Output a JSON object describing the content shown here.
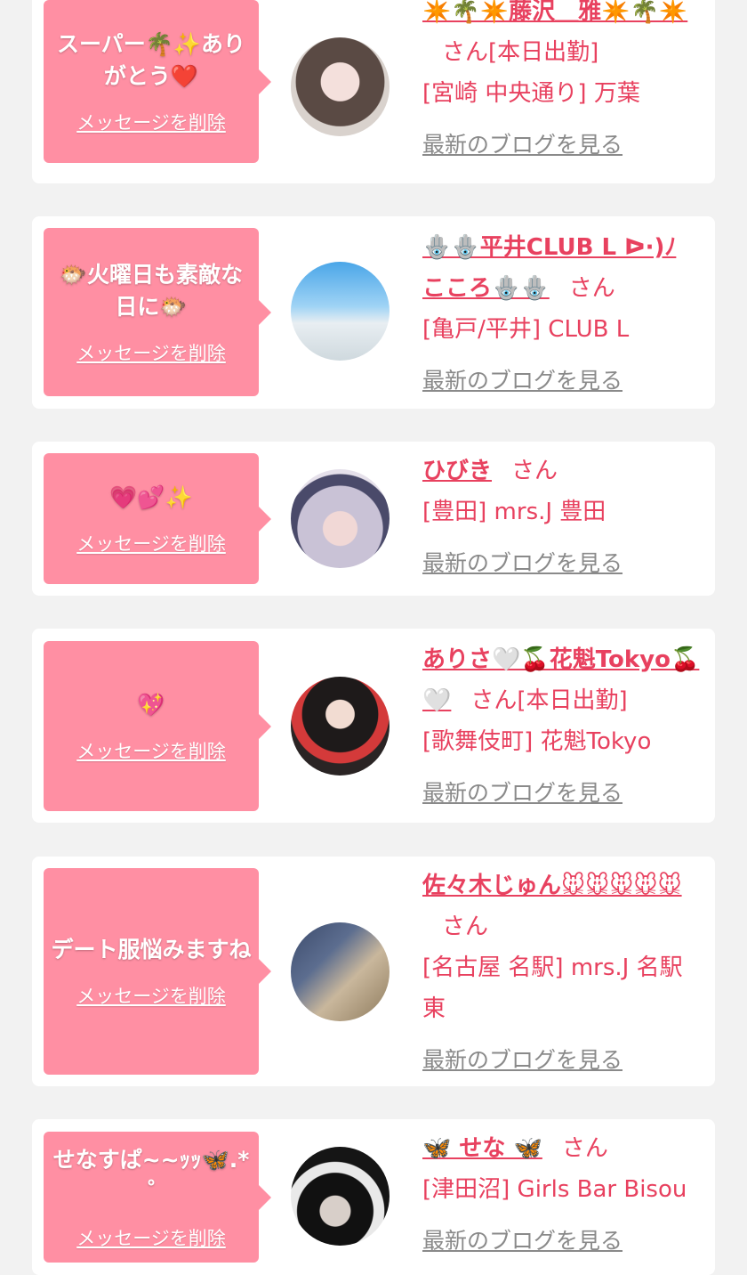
{
  "delete_label": "メッセージを削除",
  "blog_label": "最新のブログを見る",
  "honorific": "さん",
  "colors": {
    "accent": "#e8415f",
    "bubble": "#ff8fa3",
    "muted": "#8a8a8a",
    "background": "#f2f2f2"
  },
  "cards": [
    {
      "message": "スーパー🌴✨ありがとう❤️",
      "name": "✴️🌴✴️藤沢＿雅✴️🌴✴️",
      "status": "[本日出勤]",
      "shop": "[宮崎 中央通り] 万葉"
    },
    {
      "message": "🐡火曜日も素敵な日に🐡",
      "name": "🪬🪬平井CLUB L ᐅ·)ﾉ こころ🪬🪬",
      "status": "",
      "shop": "[亀戸/平井] CLUB L"
    },
    {
      "message": "💗💕✨",
      "name": "ひびき",
      "status": "",
      "shop": "[豊田] mrs.J 豊田"
    },
    {
      "message": "💖",
      "name": "ありさ🤍🍒花魁Tokyo🍒🤍",
      "status": "[本日出勤]",
      "shop": "[歌舞伎町] 花魁Tokyo"
    },
    {
      "message": "デート服悩みますね",
      "name": "佐々木じゅん🐭🐭🐭🐭🐭",
      "status": "",
      "shop": "[名古屋 名駅] mrs.J 名駅東"
    },
    {
      "message": "せなすぱ~~ｯｯ🦋.*˚",
      "name": "🦋 せな 🦋",
      "status": "",
      "shop": "[津田沼] Girls Bar Bisou"
    }
  ]
}
